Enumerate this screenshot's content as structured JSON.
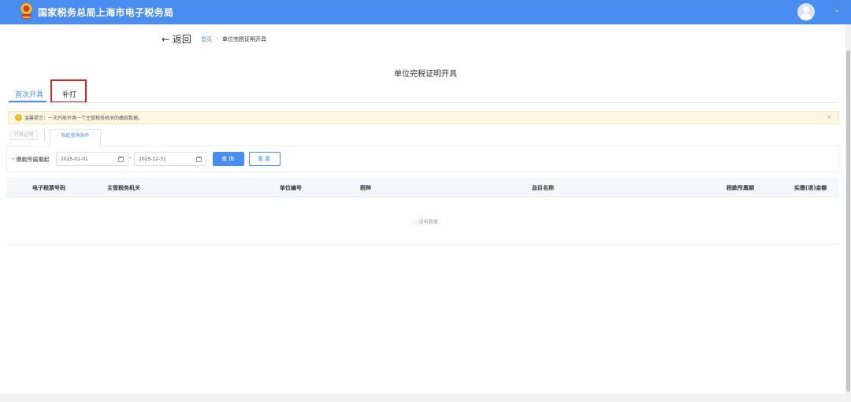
{
  "header": {
    "site_title": "国家税务总局上海市电子税务局",
    "user_chevron": "⌄"
  },
  "breadcrumb": {
    "back": "← 返回",
    "home": "首页",
    "separator": "›",
    "current": "单位完税证明开具"
  },
  "page": {
    "title": "单位完税证明开具"
  },
  "tabs": [
    {
      "label": "首次开具",
      "active": true
    },
    {
      "label": "补打",
      "active": false
    }
  ],
  "tip": {
    "icon": "!",
    "text": "温馨提示：一次只能开具一个主管税务机关的缴款数据。",
    "close": "×"
  },
  "toolbar": {
    "issue_button": "开具证明",
    "collapse_tab": "收起查询条件"
  },
  "filter": {
    "required_mark": "*",
    "label": "缴款所属期起",
    "start_date": "2025-01-01",
    "dash": "-",
    "end_date": "2025-12-31",
    "query_button": "查询",
    "reset_button": "重置"
  },
  "table": {
    "columns": [
      "电子税票号码",
      "主管税务机关",
      "单位编号",
      "税种",
      "品目名称",
      "税款所属期",
      "实缴(退)金额"
    ],
    "empty_text": "◌ 没有数据"
  },
  "colors": {
    "brand": "#4a8df0",
    "highlight": "#e02020",
    "tip_bg": "#fdf6e0"
  }
}
